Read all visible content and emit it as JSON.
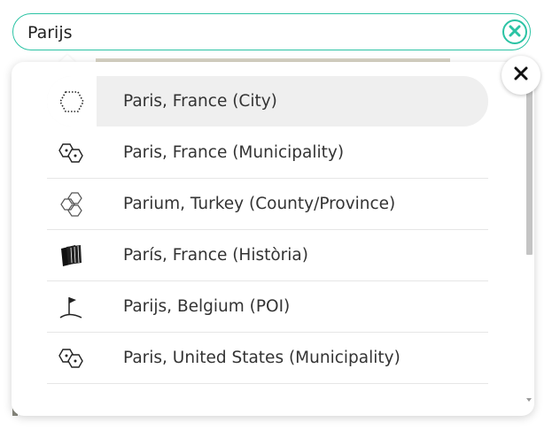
{
  "search": {
    "value": "Parijs",
    "accent_color": "#2bc3a4"
  },
  "results": [
    {
      "label": "Paris, France (City)",
      "icon": "city-outline-icon",
      "selected": true
    },
    {
      "label": "Paris, France (Municipality)",
      "icon": "municipality-icon",
      "selected": false
    },
    {
      "label": "Parium, Turkey (County/Province)",
      "icon": "county-province-icon",
      "selected": false
    },
    {
      "label": "París, France (Història)",
      "icon": "history-books-icon",
      "selected": false
    },
    {
      "label": "Parijs, Belgium (POI)",
      "icon": "poi-flag-icon",
      "selected": false
    },
    {
      "label": "Paris, United States (Municipality)",
      "icon": "municipality-icon",
      "selected": false
    }
  ],
  "partial_result_icon": "partial-result-icon",
  "controls": {
    "clear_icon": "clear-x-icon",
    "close_icon": "close-x-icon"
  }
}
